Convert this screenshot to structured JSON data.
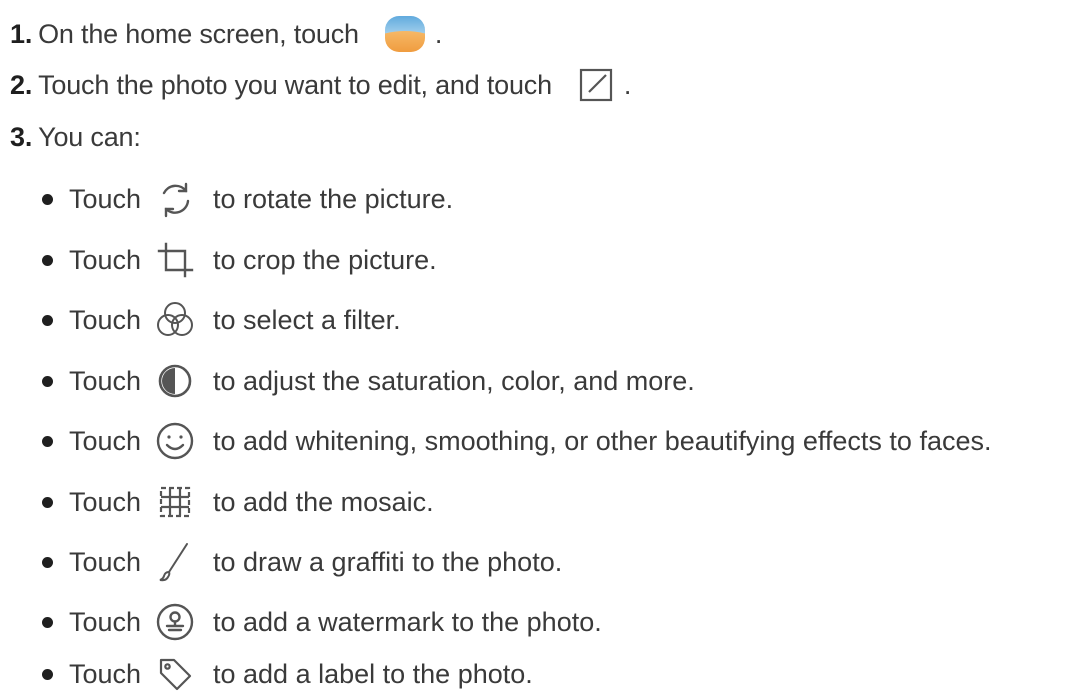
{
  "steps": [
    {
      "num": "1.",
      "text_before": "On the home screen, touch",
      "text_after": ".",
      "icon": "gallery-icon"
    },
    {
      "num": "2.",
      "text_before": "Touch the photo you want to edit, and touch",
      "text_after": ".",
      "icon": "edit-icon"
    },
    {
      "num": "3.",
      "text_before": "You can:"
    }
  ],
  "bullets": [
    {
      "touch": "Touch",
      "icon": "rotate-icon",
      "text": "to rotate the picture."
    },
    {
      "touch": "Touch",
      "icon": "crop-icon",
      "text": "to crop the picture."
    },
    {
      "touch": "Touch",
      "icon": "filter-icon",
      "text": "to select a filter."
    },
    {
      "touch": "Touch",
      "icon": "adjust-icon",
      "text": "to adjust the saturation, color, and more."
    },
    {
      "touch": "Touch",
      "icon": "beauty-face-icon",
      "text": "to add whitening, smoothing, or other beautifying effects to faces."
    },
    {
      "touch": "Touch",
      "icon": "mosaic-icon",
      "text": "to add the mosaic."
    },
    {
      "touch": "Touch",
      "icon": "brush-icon",
      "text": "to draw a graffiti to the photo."
    },
    {
      "touch": "Touch",
      "icon": "watermark-icon",
      "text": "to add a watermark to the photo."
    },
    {
      "touch": "Touch",
      "icon": "tag-icon",
      "text": "to add a label to the photo."
    }
  ],
  "colors": {
    "text": "#3a3a3a",
    "number": "#1f1f1f",
    "icon_stroke": "#666666",
    "gallery_top": "#6fb3e0",
    "gallery_bottom": "#f2a54a"
  }
}
